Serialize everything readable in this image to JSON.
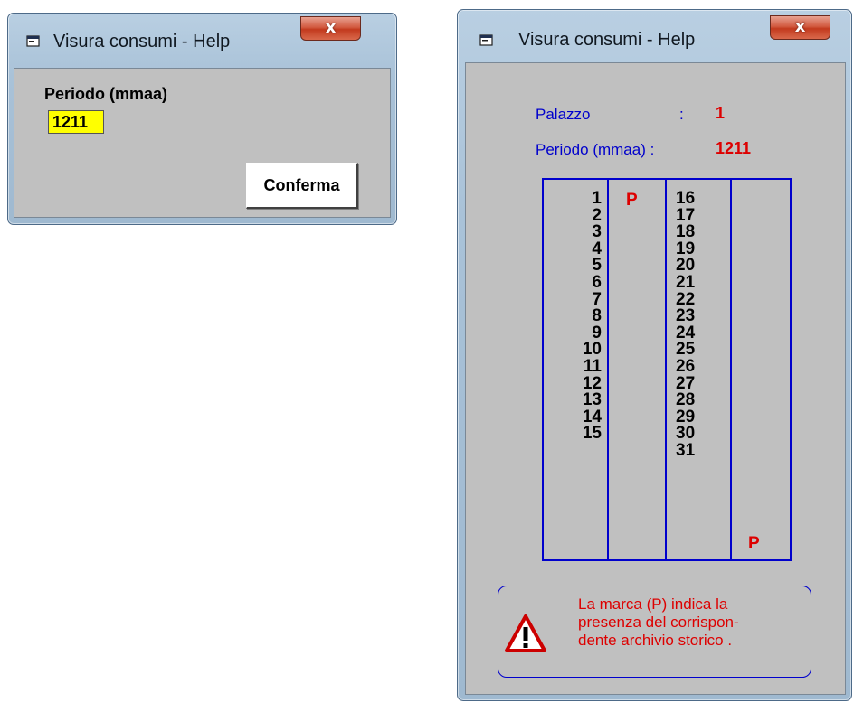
{
  "window_small": {
    "title": "Visura consumi - Help",
    "close_label": "x",
    "period_label": "Periodo (mmaa)",
    "period_value": "1211",
    "confirm_label": "Conferma"
  },
  "window_large": {
    "title": "Visura consumi - Help",
    "close_label": "x",
    "palazzo_label": "Palazzo",
    "palazzo_sep": ":",
    "palazzo_value": "1",
    "period_label": "Periodo  (mmaa) :",
    "period_value": "1211",
    "days_left": [
      "1",
      "2",
      "3",
      "4",
      "5",
      "6",
      "7",
      "8",
      "9",
      "10",
      "11",
      "12",
      "13",
      "14",
      "15"
    ],
    "days_right": [
      "16",
      "17",
      "18",
      "19",
      "20",
      "21",
      "22",
      "23",
      "24",
      "25",
      "26",
      "27",
      "28",
      "29",
      "30",
      "31"
    ],
    "mark_left": "P",
    "mark_right": "P",
    "notice_lines": [
      "La marca (P) indica la",
      "presenza del corrispon-",
      "dente archivio storico ."
    ]
  },
  "colors": {
    "label_blue": "#0000cc",
    "value_red": "#dd0000",
    "field_yellow": "#ffff00",
    "client_gray": "#c0c0c0"
  },
  "icons": {
    "title_icon": "window-app-icon",
    "close_icon": "close-icon",
    "warning_icon": "warning-triangle-icon"
  }
}
